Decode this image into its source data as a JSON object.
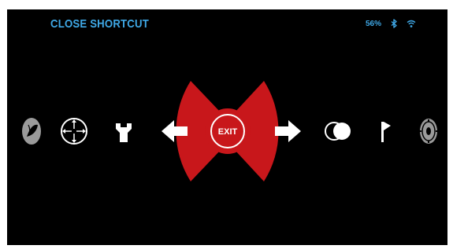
{
  "header": {
    "title": "CLOSE SHORTCUT",
    "battery_percent": "56%"
  },
  "status_icons": [
    "bluetooth-icon",
    "wifi-icon"
  ],
  "menu": {
    "center_label": "EXIT",
    "left_items": [
      "leaf-icon",
      "reticle-icon",
      "wrench-icon"
    ],
    "right_items": [
      "overlap-circles-icon",
      "flag-icon",
      "settings-gear-icon"
    ],
    "arrows": [
      "left-arrow-icon",
      "right-arrow-icon"
    ]
  },
  "colors": {
    "accent_blue": "#3fa8e6",
    "menu_red": "#c8171b",
    "icon_white": "#ffffff",
    "icon_gray": "#9a9a9a"
  }
}
